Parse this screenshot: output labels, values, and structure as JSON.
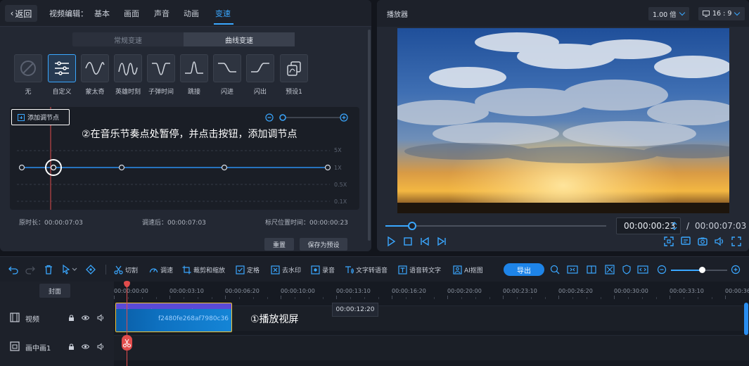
{
  "edit": {
    "back_label": "返回",
    "title": "视频编辑：",
    "tabs": [
      "基本",
      "画面",
      "声音",
      "动画",
      "变速"
    ],
    "active_tab": "变速",
    "modes": [
      "常规变速",
      "曲线变速"
    ],
    "active_mode": "曲线变速",
    "presets": [
      {
        "label": "无",
        "icon": "none-icon"
      },
      {
        "label": "自定义",
        "icon": "custom-sliders-icon"
      },
      {
        "label": "蒙太奇",
        "icon": "montage-curve-icon"
      },
      {
        "label": "英雄时刻",
        "icon": "hero-moment-curve-icon"
      },
      {
        "label": "子弹时间",
        "icon": "bullet-time-curve-icon"
      },
      {
        "label": "跳接",
        "icon": "jump-cut-curve-icon"
      },
      {
        "label": "闪进",
        "icon": "flash-in-curve-icon"
      },
      {
        "label": "闪出",
        "icon": "flash-out-curve-icon"
      },
      {
        "label": "预设1",
        "icon": "preset-copy-icon"
      }
    ],
    "selected_preset": "自定义",
    "add_node_label": "添加调节点",
    "annotation": "②在音乐节奏点处暂停，并点击按钮，添加调节点",
    "y_labels": [
      "5X",
      "1X",
      "0.5X",
      "0.1X"
    ],
    "curve_zoom": 0.0,
    "info": {
      "original_duration": "原时长：00:00:07:03",
      "after_speed": "调速后：00:00:07:03",
      "ruler_position": "标尺位置时间：00:00:00:23"
    },
    "reset_label": "重置",
    "save_preset_label": "保存为预设"
  },
  "player": {
    "title": "播放器",
    "speed_option": "1.00 倍",
    "aspect_option": "16 : 9",
    "progress": 0.12,
    "current_time": "00:00:00:23",
    "separator": "/",
    "total_time": "00:00:07:03"
  },
  "toolbar": {
    "items": [
      {
        "label": "切割",
        "icon": "scissors-icon"
      },
      {
        "label": "调速",
        "icon": "speedometer-icon"
      },
      {
        "label": "裁剪和缩放",
        "icon": "crop-icon"
      },
      {
        "label": "定格",
        "icon": "freeze-frame-icon"
      },
      {
        "label": "去水印",
        "icon": "remove-watermark-icon"
      },
      {
        "label": "录音",
        "icon": "record-audio-icon"
      },
      {
        "label": "文字转语音",
        "icon": "text-to-speech-icon"
      },
      {
        "label": "语音转文字",
        "icon": "speech-to-text-icon"
      },
      {
        "label": "AI抠图",
        "icon": "ai-cutout-icon"
      }
    ],
    "export_label": "导出",
    "zoom_level": 0.55
  },
  "timeline": {
    "cover_label": "封面",
    "tracks": [
      {
        "name": "视频",
        "icon": "video-track-icon"
      },
      {
        "name": "画中画1",
        "icon": "pip-track-icon"
      }
    ],
    "ruler_labels": [
      "00:00:00:00",
      "00:00:03:10",
      "00:00:06:20",
      "00:00:10:00",
      "00:00:13:10",
      "00:00:16:20",
      "00:00:20:00",
      "00:00:23:10",
      "00:00:26:20",
      "00:00:30:00",
      "00:00:33:10",
      "00:00:36"
    ],
    "clip_name": "f2480fe268af7980c36",
    "tooltip_time": "00:00:12:20",
    "annotation": "①播放视屏"
  }
}
